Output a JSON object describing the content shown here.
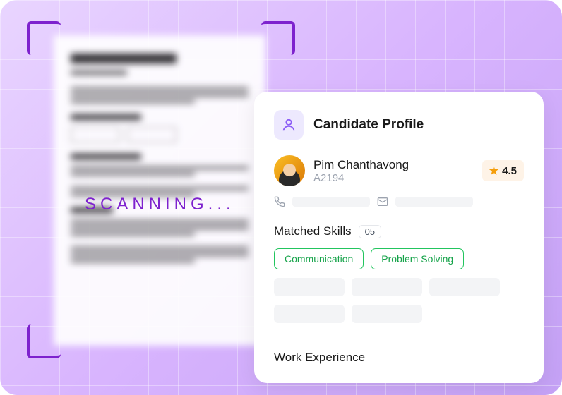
{
  "scanning_label": "SCANNING...",
  "profile": {
    "title": "Candidate Profile",
    "name": "Pim Chanthavong",
    "id": "A2194",
    "rating": "4.5"
  },
  "skills": {
    "section_title": "Matched Skills",
    "count": "05",
    "items": [
      "Communication",
      "Problem Solving"
    ]
  },
  "work_experience": {
    "section_title": "Work Experience"
  }
}
